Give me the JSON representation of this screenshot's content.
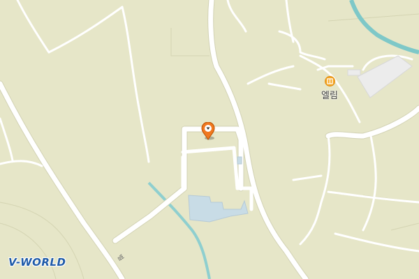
{
  "map": {
    "poi": {
      "label": "엘림",
      "icon": "building-icon",
      "color": "#f5a623"
    },
    "marker": {
      "icon": "location-pin-icon",
      "color": "#f07820"
    },
    "road_label": "벌",
    "logo": {
      "text": "V-WORLD"
    },
    "colors": {
      "land": "#e6e6c8",
      "road": "#ffffff",
      "road_edge": "#d2d2b4",
      "water": "#7ec8c8",
      "building": "#c8dce6"
    }
  }
}
